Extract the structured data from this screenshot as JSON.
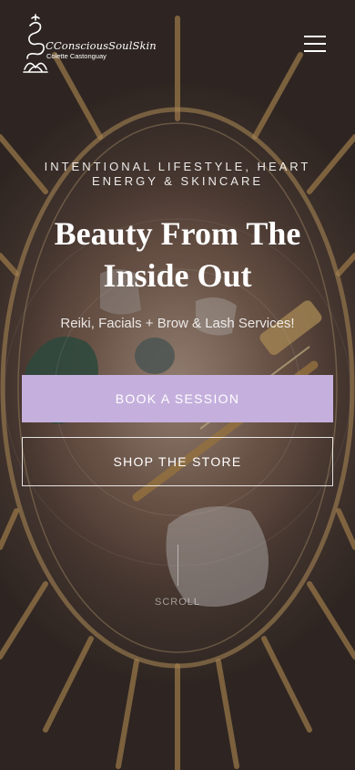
{
  "brand": {
    "title": "CConsciousSoulSkin",
    "subtitle": "Colette Castonguay"
  },
  "header": {
    "menu_icon": "hamburger-menu-icon"
  },
  "hero": {
    "eyebrow": "INTENTIONAL LIFESTYLE, HEART ENERGY & SKINCARE",
    "headline": "Beauty From The Inside Out",
    "subhead": "Reiki, Facials + Brow & Lash Services!",
    "primary_cta": "BOOK A SESSION",
    "secondary_cta": "SHOP THE STORE",
    "scroll_label": "SCROLL"
  },
  "colors": {
    "primary_button": "#c5b0dd",
    "text": "#ffffff"
  }
}
